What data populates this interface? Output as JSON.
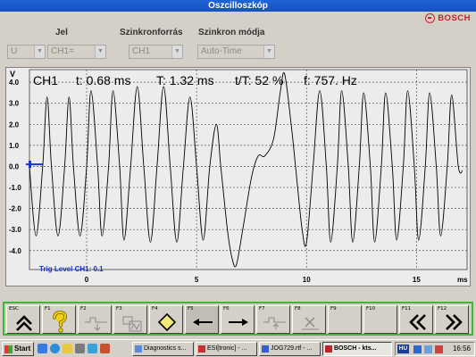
{
  "window": {
    "title": "Oszcilloszkóp"
  },
  "brand": {
    "name": "BOSCH"
  },
  "controls": {
    "jel": {
      "label": "Jel",
      "value1": "U",
      "value2": "CH1="
    },
    "sync_source": {
      "label": "Szinkronforrás",
      "value": "CH1"
    },
    "sync_mode": {
      "label": "Szinkron módja",
      "value": "Auto-Time"
    }
  },
  "readout": {
    "channel": "CH1",
    "t": "t: 0.68 ms",
    "T": "T:  1.32 ms",
    "duty": "t/T:  52 %",
    "freq": "f: 757. Hz"
  },
  "trig_level": "Trig Level CH1:  0.1",
  "chart_data": {
    "type": "line",
    "ylabel": "V",
    "xlabel": "ms",
    "xlim": [
      -2.6,
      17.3
    ],
    "ylim": [
      -4.9,
      4.6
    ],
    "y_ticks": [
      "4.0",
      "3.0",
      "2.0",
      "1.0",
      "0.0",
      "-1.0",
      "-2.0",
      "-3.0",
      "-4.0"
    ],
    "x_ticks": [
      "0",
      "5",
      "10",
      "15"
    ],
    "x_tick_values": [
      0,
      5,
      10,
      15
    ],
    "y_tick_values": [
      4,
      3,
      2,
      1,
      0,
      -1,
      -2,
      -3,
      -4
    ],
    "trigger_level_v": 0.1,
    "series": [
      {
        "points": [
          [
            -2.6,
            0
          ],
          [
            -2.3,
            -3.3
          ],
          [
            -2.0,
            0
          ],
          [
            -1.8,
            3.3
          ],
          [
            -1.6,
            0
          ],
          [
            -1.3,
            -3.3
          ],
          [
            -1.0,
            0
          ],
          [
            -0.8,
            3.3
          ],
          [
            -0.6,
            0
          ],
          [
            -0.3,
            -3.3
          ],
          [
            0.0,
            0
          ],
          [
            0.2,
            3.6
          ],
          [
            0.5,
            0
          ],
          [
            0.7,
            -3.3
          ],
          [
            1.0,
            0
          ],
          [
            1.2,
            3.6
          ],
          [
            1.5,
            0
          ],
          [
            1.7,
            -3.5
          ],
          [
            2.0,
            0
          ],
          [
            2.3,
            3.8
          ],
          [
            2.6,
            0
          ],
          [
            2.9,
            -3.6
          ],
          [
            3.2,
            0
          ],
          [
            3.5,
            3.8
          ],
          [
            3.8,
            0
          ],
          [
            4.1,
            -3.6
          ],
          [
            4.4,
            0
          ],
          [
            4.7,
            3.3
          ],
          [
            5.0,
            0
          ],
          [
            5.3,
            -3.5
          ],
          [
            5.6,
            0
          ],
          [
            5.9,
            2.0
          ],
          [
            6.1,
            0
          ],
          [
            6.4,
            -3.0
          ],
          [
            6.6,
            -4.3
          ],
          [
            6.8,
            -4.7
          ],
          [
            7.1,
            -3.0
          ],
          [
            7.5,
            -0.5
          ],
          [
            7.8,
            0.5
          ],
          [
            8.1,
            0.5
          ],
          [
            8.5,
            1.3
          ],
          [
            8.8,
            3.5
          ],
          [
            9.0,
            4.4
          ],
          [
            9.3,
            2.0
          ],
          [
            9.5,
            0
          ],
          [
            9.8,
            -3.0
          ],
          [
            10.0,
            -3.6
          ],
          [
            10.3,
            0
          ],
          [
            10.6,
            3.6
          ],
          [
            10.9,
            0
          ],
          [
            11.1,
            -3.6
          ],
          [
            11.4,
            0
          ],
          [
            11.6,
            3.6
          ],
          [
            11.9,
            0
          ],
          [
            12.1,
            -3.6
          ],
          [
            12.4,
            0
          ],
          [
            12.6,
            3.5
          ],
          [
            12.9,
            0
          ],
          [
            13.1,
            -3.6
          ],
          [
            13.4,
            0
          ],
          [
            13.6,
            3.5
          ],
          [
            13.9,
            0
          ],
          [
            14.1,
            -3.5
          ],
          [
            14.4,
            0
          ],
          [
            14.6,
            3.6
          ],
          [
            14.9,
            0
          ],
          [
            15.1,
            -3.5
          ],
          [
            15.4,
            0
          ],
          [
            15.6,
            3.5
          ],
          [
            15.9,
            0
          ],
          [
            16.1,
            -3.3
          ],
          [
            16.4,
            0
          ],
          [
            16.6,
            3.4
          ],
          [
            16.9,
            0
          ],
          [
            17.1,
            -0.2
          ]
        ]
      }
    ]
  },
  "fkeys": [
    {
      "key": "ESC",
      "icon": "double-chevron-up-icon"
    },
    {
      "key": "F1",
      "icon": "help-question-icon"
    },
    {
      "key": "F2",
      "icon": "waveform-down-icon"
    },
    {
      "key": "F3",
      "icon": "waveform-zoom-icon"
    },
    {
      "key": "F4",
      "icon": "diamond-icon"
    },
    {
      "key": "F5",
      "icon": "arrow-left-icon"
    },
    {
      "key": "F6",
      "icon": "arrow-right-icon"
    },
    {
      "key": "F7",
      "icon": "waveform-up-icon"
    },
    {
      "key": "F8",
      "icon": "delete-x-icon"
    },
    {
      "key": "F9",
      "icon": ""
    },
    {
      "key": "F10",
      "icon": ""
    },
    {
      "key": "F11",
      "icon": "double-chevron-left-icon"
    },
    {
      "key": "F12",
      "icon": "double-chevron-right-icon"
    }
  ],
  "taskbar": {
    "start": "Start",
    "tasks": [
      "Diagnostics s...",
      "ESI[tronic] - ...",
      "JOG729.rtf - ...",
      "BOSCH - kts..."
    ],
    "lang": "HU",
    "clock": "16:56"
  },
  "colors": {
    "titlebar": "#1550c0",
    "scope_bg": "#ececec",
    "trace": "#000000",
    "trigger": "#1a34c8",
    "fkey_border": "#3cb832",
    "brand": "#c0242b"
  }
}
